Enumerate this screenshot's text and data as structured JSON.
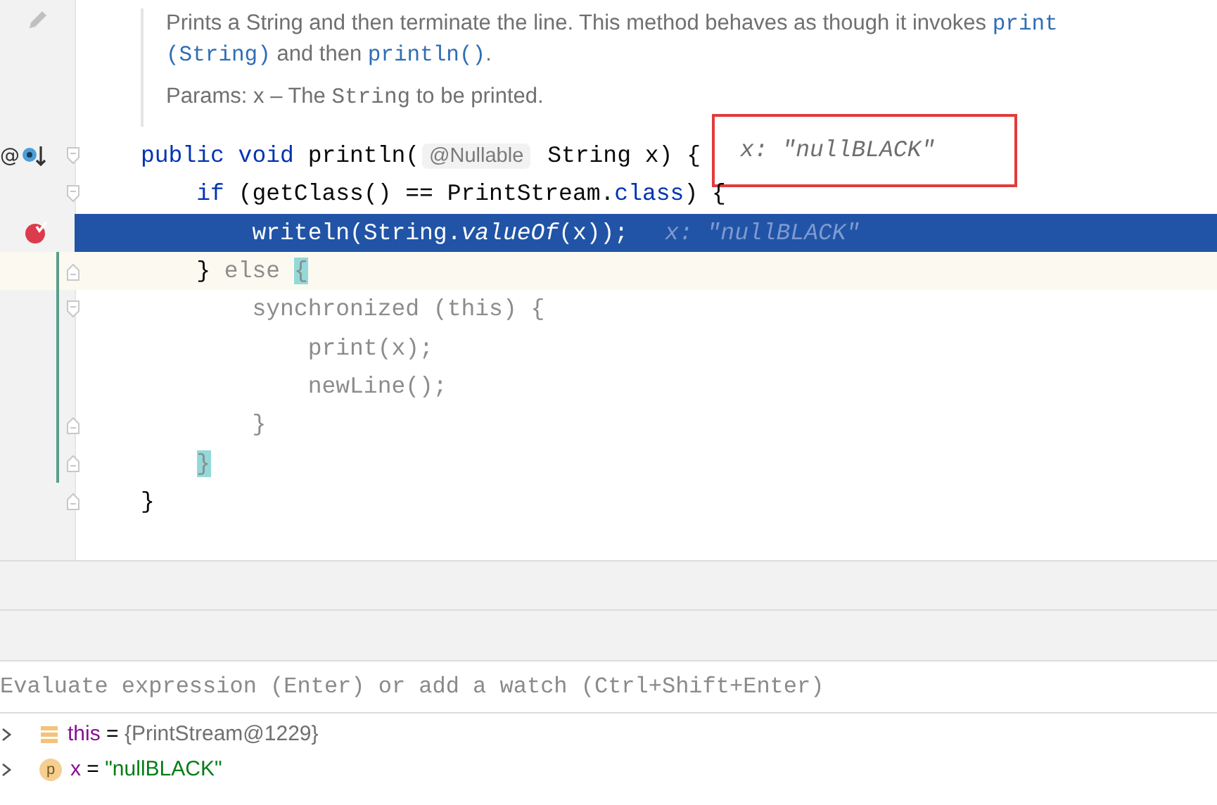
{
  "doc": {
    "lines": [
      [
        {
          "text": "Prints a String and then terminate the line. This method behaves as though it invokes ",
          "kind": "text"
        },
        {
          "text": "print",
          "kind": "link"
        }
      ],
      [
        {
          "text": "(String)",
          "kind": "link"
        },
        {
          "text": " and then ",
          "kind": "text"
        },
        {
          "text": "println()",
          "kind": "link"
        },
        {
          "text": ".",
          "kind": "text"
        }
      ]
    ],
    "params": [
      {
        "text": "Params: x – The ",
        "kind": "text"
      },
      {
        "text": "String",
        "kind": "code"
      },
      {
        "text": " to be printed.",
        "kind": "text"
      }
    ]
  },
  "code_lines": [
    {
      "gutter_text": "@",
      "gutter_icons": [
        {
          "kind": "override"
        },
        {
          "kind": "fold_start"
        }
      ],
      "current": false,
      "caret": false,
      "tokens": [
        {
          "text": "public void",
          "kind": "keyword"
        },
        {
          "text": " println(",
          "kind": "plain"
        },
        {
          "text": "@Nullable",
          "kind": "inlay"
        },
        {
          "text": " String x) {",
          "kind": "plain"
        }
      ],
      "value_hint": {
        "text": "x: \"nullBLACK\"",
        "framed": true
      }
    },
    {
      "gutter_icons": [
        {
          "kind": "fold_start"
        }
      ],
      "current": false,
      "caret": false,
      "tokens": [
        {
          "text": "    if",
          "kind": "keyword"
        },
        {
          "text": " (getClass() == PrintStream.",
          "kind": "plain"
        },
        {
          "text": "class",
          "kind": "keyword"
        },
        {
          "text": ") {",
          "kind": "plain"
        }
      ]
    },
    {
      "gutter_icons": [
        {
          "kind": "breakpoint"
        }
      ],
      "current": true,
      "caret": false,
      "tokens": [
        {
          "text": "        writeln(String.",
          "kind": "plain"
        },
        {
          "text": "valueOf",
          "kind": "italic"
        },
        {
          "text": "(x));",
          "kind": "plain"
        }
      ],
      "value_hint": {
        "text": "x: \"nullBLACK\"",
        "framed": false
      }
    },
    {
      "gutter_icons": [
        {
          "kind": "change_bar"
        },
        {
          "kind": "fold_end"
        }
      ],
      "current": false,
      "caret": true,
      "tokens": [
        {
          "text": "    } ",
          "kind": "plain"
        },
        {
          "text": "else ",
          "kind": "muted"
        },
        {
          "text": "{",
          "kind": "brace"
        }
      ]
    },
    {
      "gutter_icons": [
        {
          "kind": "change_bar"
        },
        {
          "kind": "fold_start"
        }
      ],
      "current": false,
      "caret": false,
      "tokens": [
        {
          "text": "        synchronized (this) {",
          "kind": "muted"
        }
      ]
    },
    {
      "gutter_icons": [
        {
          "kind": "change_bar"
        }
      ],
      "current": false,
      "caret": false,
      "tokens": [
        {
          "text": "            print(x);",
          "kind": "muted"
        }
      ]
    },
    {
      "gutter_icons": [
        {
          "kind": "change_bar"
        }
      ],
      "current": false,
      "caret": false,
      "tokens": [
        {
          "text": "            newLine();",
          "kind": "muted"
        }
      ]
    },
    {
      "gutter_icons": [
        {
          "kind": "change_bar"
        },
        {
          "kind": "fold_end"
        }
      ],
      "current": false,
      "caret": false,
      "tokens": [
        {
          "text": "        }",
          "kind": "muted"
        }
      ]
    },
    {
      "gutter_icons": [
        {
          "kind": "change_bar"
        },
        {
          "kind": "fold_end"
        }
      ],
      "current": false,
      "caret": false,
      "tokens": [
        {
          "text": "    }",
          "kind": "brace"
        }
      ]
    },
    {
      "gutter_icons": [
        {
          "kind": "fold_end"
        }
      ],
      "current": false,
      "caret": false,
      "tokens": [
        {
          "text": "}",
          "kind": "plain"
        }
      ]
    }
  ],
  "evaluate": {
    "placeholder": "Evaluate expression (Enter) or add a watch (Ctrl+Shift+Enter)"
  },
  "variables": [
    {
      "kind": "field",
      "name": "this",
      "sep": "=",
      "value": "{PrintStream@1229}",
      "expanded": false
    },
    {
      "kind": "parameter",
      "badge": "p",
      "name": "x",
      "sep": "=",
      "value": "\"nullBLACK\"",
      "expanded": false
    }
  ]
}
